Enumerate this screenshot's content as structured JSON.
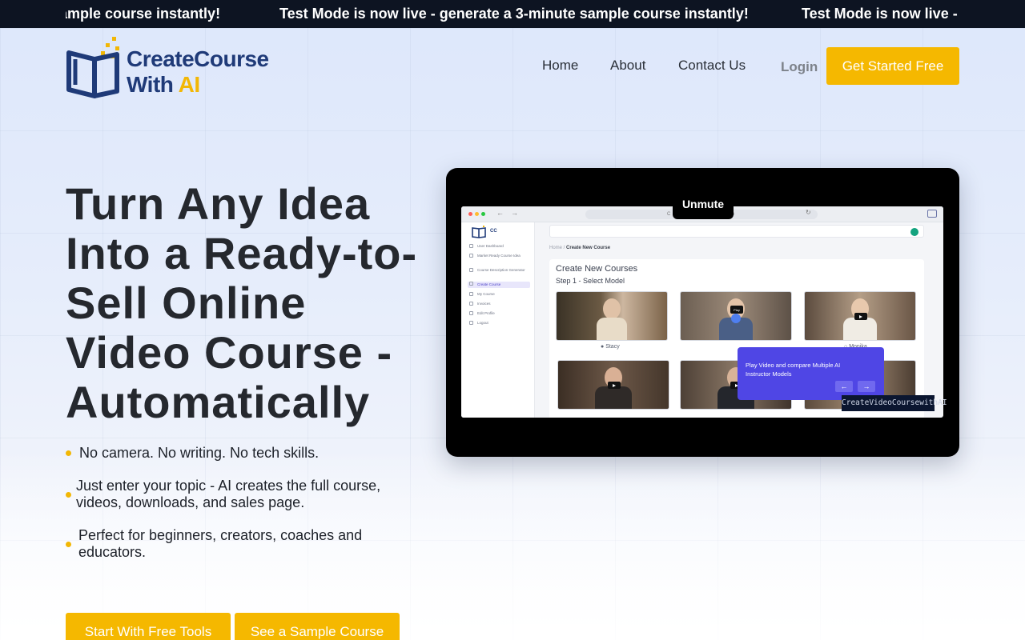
{
  "ticker": {
    "items": [
      "ample course instantly!",
      "Test Mode is now live - generate a 3-minute sample course instantly!",
      "Test Mode is now live -"
    ]
  },
  "header": {
    "logo_line1": "CreateCourse",
    "logo_line2": "With",
    "logo_line2_accent": "AI",
    "nav": [
      {
        "label": "Home"
      },
      {
        "label": "About"
      },
      {
        "label": "Contact Us"
      }
    ],
    "login_label": "Login",
    "cta_label": "Get Started Free"
  },
  "hero": {
    "title": "Turn Any Idea Into a Ready-to-Sell Online Video Course - Automatically",
    "bullets": [
      "No camera. No writing. No tech skills.",
      "Just enter your topic - AI creates the full course,\nvideos, downloads, and sales page.",
      "Perfect for beginners, creators, coaches and\neducators."
    ],
    "cta_primary": "Start With Free Tools",
    "cta_secondary": "See a Sample Course"
  },
  "video": {
    "unmute_label": "Unmute",
    "screen": {
      "url": "C",
      "url_right": "e",
      "brand": "CC",
      "sidebar": [
        "User Dashboard",
        "Market Ready Course Idea",
        "Course Description Generator",
        "Create Course",
        "My Course",
        "Invoices",
        "Edit Profile",
        "Logout"
      ],
      "sidebar_active_index": 3,
      "breadcrumb_home": "Home",
      "breadcrumb_current": "Create New Course",
      "panel_title": "Create New Courses",
      "panel_subtitle": "Step 1 - Select Model",
      "instructors": [
        {
          "name": "Stacy"
        },
        {
          "name": ""
        },
        {
          "name": "Monika"
        },
        {
          "name": ""
        },
        {
          "name": ""
        },
        {
          "name": ""
        }
      ],
      "tooltip_text": "Play Video and compare Multiple AI\nInstructor Models",
      "tooltip_prev": "←",
      "tooltip_next": "→",
      "play_label": "Play"
    },
    "watermark": "CreateVideoCoursewithAI"
  },
  "colors": {
    "accent": "#f5b800",
    "ticker_bg": "#0d1422",
    "tooltip": "#4f46e5",
    "logo_blue": "#1f3a78"
  }
}
